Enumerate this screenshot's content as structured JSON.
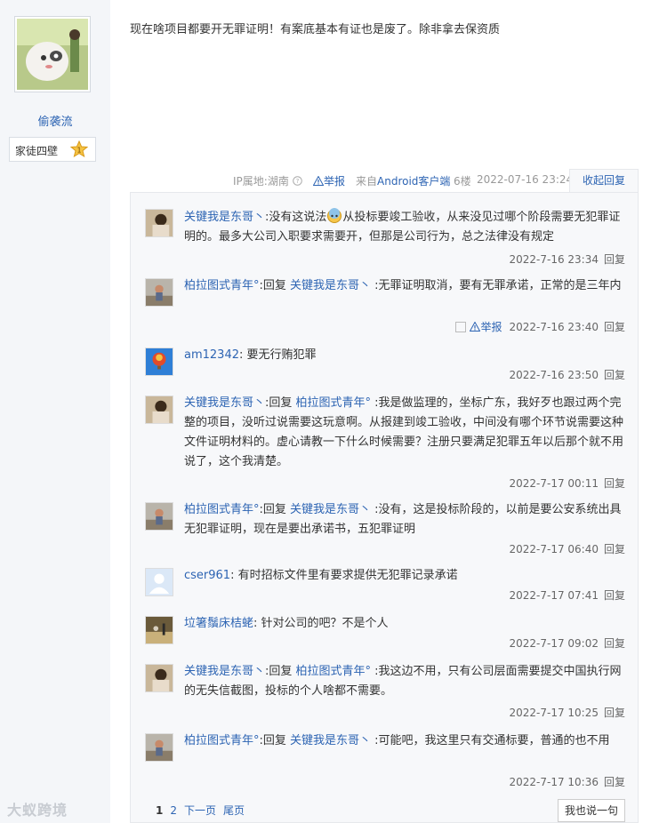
{
  "post": {
    "username": "偷袭流",
    "level_name": "家徒四壁",
    "level_number": "1",
    "text": "现在啥项目都要开无罪证明！有案底基本有证也是废了。除非拿去保资质",
    "meta": {
      "ip_location": "IP属地:湖南",
      "report": "举报",
      "client_prefix": "来自",
      "client": "Android客户端",
      "floor": "6楼",
      "time": "2022-07-16 23:24",
      "collapse_label": "收起回复"
    }
  },
  "replies": [
    {
      "author": "关键我是东哥丶",
      "reply_word": "",
      "target": "",
      "text_before_emoji": ":没有这说法",
      "text_after_emoji": "从投标要竣工验收，从来没见过哪个阶段需要无犯罪证明的。最多大公司入职要求需要开，但那是公司行为，总之法律没有规定",
      "time": "2022-7-16 23:34",
      "reply_label": "回复"
    },
    {
      "author": "柏拉图式青年°",
      "reply_word": ":回复 ",
      "target": "关键我是东哥丶",
      "text": " :无罪证明取消，要有无罪承诺，正常的是三年内",
      "time": "2022-7-16 23:40",
      "reply_label": "回复",
      "report": "举报"
    },
    {
      "author": "am12342",
      "text": ": 要无行贿犯罪",
      "time": "2022-7-16 23:50",
      "reply_label": "回复"
    },
    {
      "author": "关键我是东哥丶",
      "reply_word": ":回复 ",
      "target": "柏拉图式青年°",
      "text": " :我是做监理的，坐标广东，我好歹也跟过两个完整的项目，没听过说需要这玩意啊。从报建到竣工验收，中间没有哪个环节说需要这种文件证明材料的。虚心请教一下什么时候需要？注册只要满足犯罪五年以后那个就不用说了，这个我清楚。",
      "time": "2022-7-17 00:11",
      "reply_label": "回复"
    },
    {
      "author": "柏拉图式青年°",
      "reply_word": ":回复 ",
      "target": "关键我是东哥丶",
      "text": " :没有，这是投标阶段的，以前是要公安系统出具无犯罪证明，现在是要出承诺书，五犯罪证明",
      "time": "2022-7-17 06:40",
      "reply_label": "回复"
    },
    {
      "author": "cser961",
      "text": ": 有时招标文件里有要求提供无犯罪记录承诺",
      "time": "2022-7-17 07:41",
      "reply_label": "回复"
    },
    {
      "author": "垃箸鬚床桔蛯",
      "text": ": 针对公司的吧？不是个人",
      "time": "2022-7-17 09:02",
      "reply_label": "回复"
    },
    {
      "author": "关键我是东哥丶",
      "reply_word": ":回复 ",
      "target": "柏拉图式青年°",
      "text": " :我这边不用，只有公司层面需要提交中国执行网的无失信截图，投标的个人啥都不需要。",
      "time": "2022-7-17 10:25",
      "reply_label": "回复"
    },
    {
      "author": "柏拉图式青年°",
      "reply_word": ":回复 ",
      "target": "关键我是东哥丶",
      "text": " :可能吧，我这里只有交通标要，普通的也不用",
      "time": "2022-7-17 10:36",
      "reply_label": "回复"
    }
  ],
  "pager": {
    "current": "1",
    "page2": "2",
    "next": "下一页",
    "last": "尾页"
  },
  "say_button": "我也说一句",
  "watermark": "大蚁跨境",
  "colors": {
    "link": "#2d64b3",
    "sidebar_bg": "#f4f6f9",
    "reply_bg": "#f7f8fa"
  }
}
